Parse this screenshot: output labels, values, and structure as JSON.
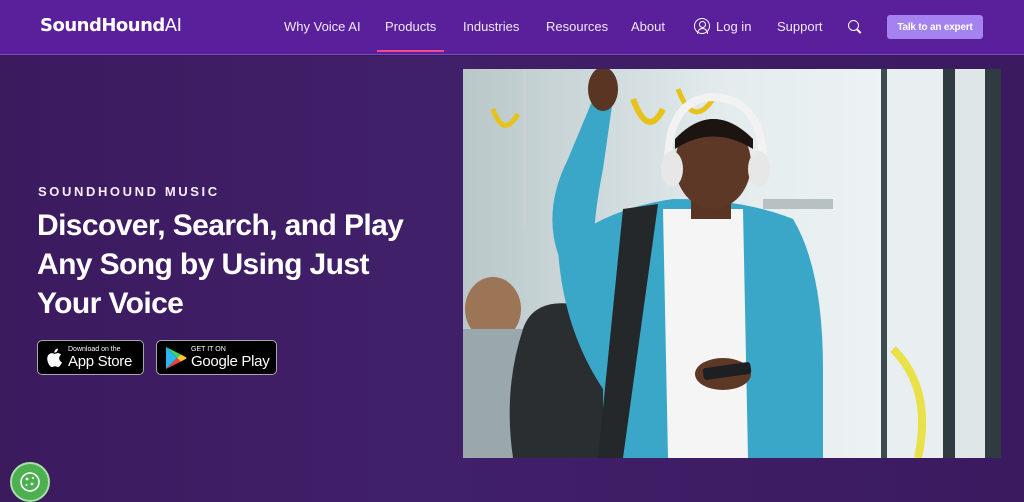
{
  "brand": {
    "name": "SoundHound",
    "suffix": "AI"
  },
  "nav": {
    "items": [
      {
        "label": "Why Voice AI"
      },
      {
        "label": "Products"
      },
      {
        "label": "Industries"
      },
      {
        "label": "Resources"
      },
      {
        "label": "About"
      }
    ],
    "login_label": "Log in",
    "support_label": "Support",
    "cta_label": "Talk to an expert"
  },
  "hero": {
    "eyebrow": "SOUNDHOUND MUSIC",
    "headline": "Discover, Search, and Play Any Song by Using Just Your Voice",
    "app_store": {
      "small": "Download on the",
      "big": "App Store"
    },
    "google_play": {
      "small": "GET IT ON",
      "big": "Google Play"
    }
  },
  "colors": {
    "nav_bg": "#5a1f9a",
    "hero_bg": "#3b1a5e",
    "cta_bg": "#a482f0",
    "active_underline": "#ec4d8a",
    "cookie_bg": "#4caf50"
  },
  "icons": {
    "login": "user-circle-icon",
    "search": "search-icon",
    "apple": "apple-icon",
    "google_play": "google-play-icon",
    "cookie": "cookie-icon"
  }
}
